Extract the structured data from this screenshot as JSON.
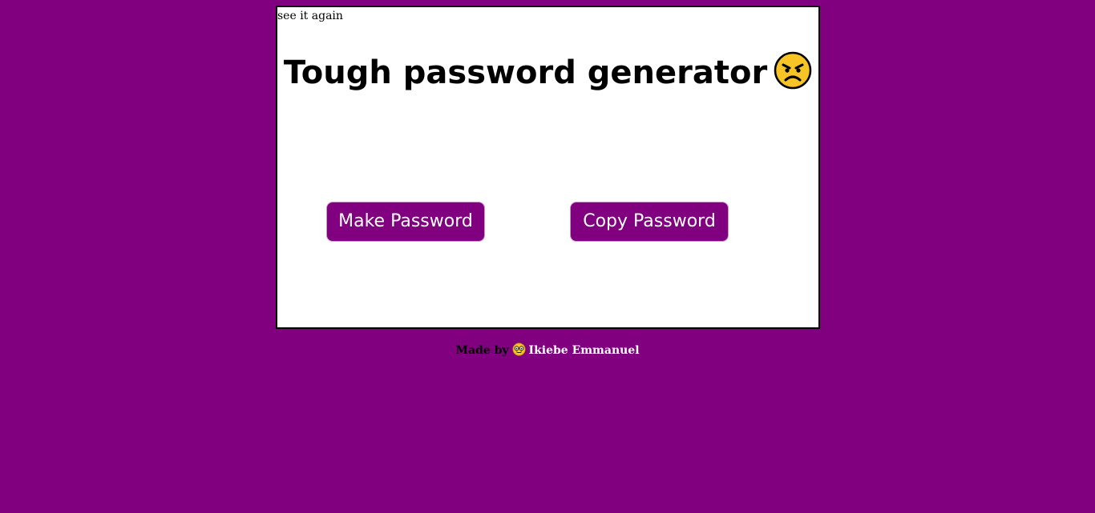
{
  "card": {
    "see_again_link": "see it again",
    "title": "Tough password generator",
    "title_emoji": "angry-face-icon",
    "make_button": "Make Password",
    "copy_button": "Copy Password"
  },
  "footer": {
    "made_by": "Made by",
    "emoji": "nerd-face-icon",
    "author": "Ikiebe Emmanuel"
  },
  "colors": {
    "background": "#800080",
    "button": "#800080",
    "card": "#ffffff"
  }
}
